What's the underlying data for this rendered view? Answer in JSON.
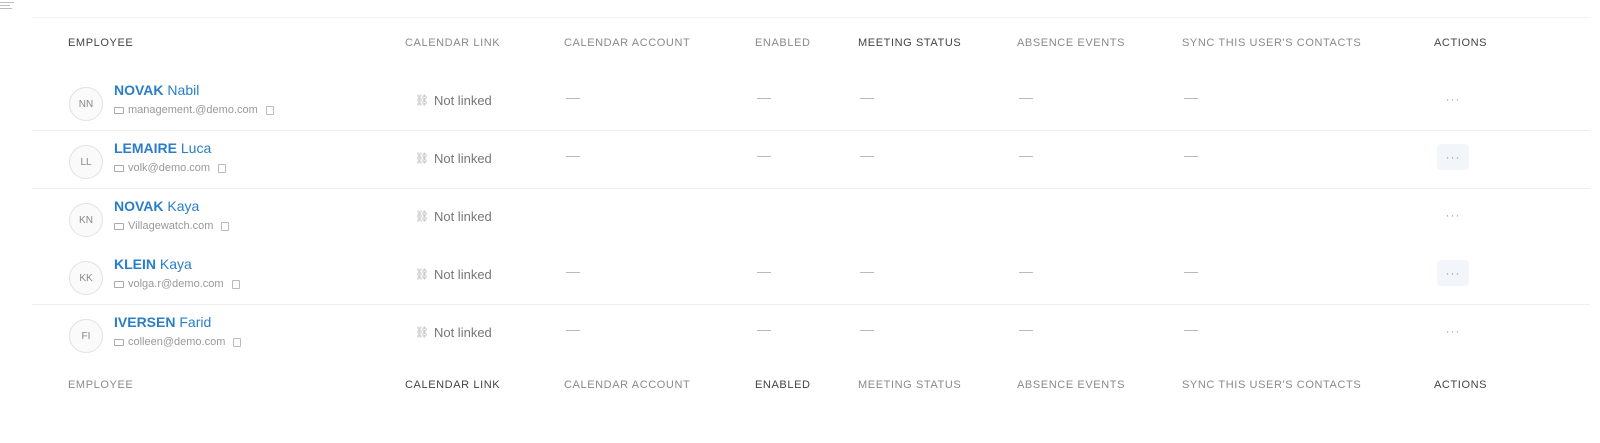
{
  "columns": [
    "Employee",
    "Calendar link",
    "Calendar account",
    "Enabled",
    "Meeting status",
    "Absence events",
    "Sync this user's contacts",
    "Actions"
  ],
  "rows": [
    {
      "initials": "NN",
      "last_name": "NOVAK",
      "first_name": "Nabil",
      "email": "management.@demo.com",
      "calendar_link": "Not linked",
      "calendar_account": "—",
      "enabled": "—",
      "meeting_status": "—",
      "absence_events": "—",
      "sync_contacts": "—",
      "action": "···"
    },
    {
      "initials": "LL",
      "last_name": "LEMAIRE",
      "first_name": "Luca",
      "email": "volk@demo.com",
      "calendar_link": "Not linked",
      "calendar_account": "—",
      "enabled": "—",
      "meeting_status": "—",
      "absence_events": "—",
      "sync_contacts": "—",
      "action": "···"
    },
    {
      "initials": "KN",
      "last_name": "NOVAK",
      "first_name": "Kaya",
      "email": "Villagewatch.com",
      "calendar_link": "Not linked",
      "calendar_account": "",
      "enabled": "",
      "meeting_status": "",
      "absence_events": "",
      "sync_contacts": "",
      "action": "···"
    },
    {
      "initials": "KK",
      "last_name": "KLEIN",
      "first_name": "Kaya",
      "email": "volga.r@demo.com",
      "calendar_link": "Not linked",
      "calendar_account": "—",
      "enabled": "—",
      "meeting_status": "—",
      "absence_events": "—",
      "sync_contacts": "—",
      "action": "···"
    },
    {
      "initials": "FI",
      "last_name": "IVERSEN",
      "first_name": "Farid",
      "email": "colleen@demo.com",
      "calendar_link": "Not linked",
      "calendar_account": "—",
      "enabled": "—",
      "meeting_status": "—",
      "absence_events": "—",
      "sync_contacts": "—",
      "action": "···"
    }
  ],
  "icons": {
    "menu": "menu-icon",
    "email": "mail-icon",
    "copy": "copy-icon",
    "unlink": "unlink-icon",
    "actions": "more-icon"
  },
  "colors": {
    "link": "#2a7ec9",
    "header_text": "#8a8a8a",
    "action_bg": "#f2f5fa"
  }
}
